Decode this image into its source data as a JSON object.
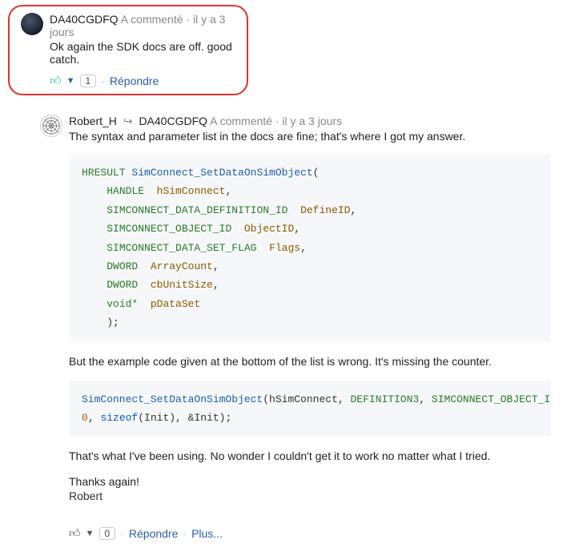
{
  "comment1": {
    "username": "DA40CGDFQ",
    "action": "A commenté",
    "time": "il y a 3 jours",
    "text": "Ok again the SDK docs are off. good catch.",
    "vote_count": "1",
    "reply_label": "Répondre"
  },
  "comment2": {
    "username": "Robert_H",
    "reply_to": "DA40CGDFQ",
    "action": "A commenté",
    "time": "il y a 3 jours",
    "intro": "The syntax and parameter list in the docs are fine; that's where I got my answer.",
    "mid_text": "But the example code given at the bottom of the list is wrong. It's missing the counter.",
    "after_text": "That's what I've been using. No wonder I couldn't get it to work no matter what I tried.",
    "thanks": "Thanks again!",
    "signoff": "Robert",
    "vote_count": "0",
    "reply_label": "Répondre",
    "more_label": "Plus..."
  },
  "code1": {
    "l1_t1": "HRESULT",
    "l1_f": "SimConnect_SetDataOnSimObject",
    "l1_p": "(",
    "l2_t": "HANDLE",
    "l2_n": "hSimConnect",
    "l2_c": ",",
    "l3_t": "SIMCONNECT_DATA_DEFINITION_ID",
    "l3_n": "DefineID",
    "l3_c": ",",
    "l4_t": "SIMCONNECT_OBJECT_ID",
    "l4_n": "ObjectID",
    "l4_c": ",",
    "l5_t": "SIMCONNECT_DATA_SET_FLAG",
    "l5_n": "Flags",
    "l5_c": ",",
    "l6_t": "DWORD",
    "l6_n": "ArrayCount",
    "l6_c": ",",
    "l7_t": "DWORD",
    "l7_n": "cbUnitSize",
    "l7_c": ",",
    "l8_t": "void*",
    "l8_n": "pDataSet",
    "l9": ");"
  },
  "code2": {
    "fn": "SimConnect_SetDataOnSimObject",
    "a1": "(hSimConnect, ",
    "a2": "DEFINITION3",
    "a3": ", ",
    "a4": "SIMCONNECT_OBJECT_ID_USER",
    "a5": ",",
    "b1": "0",
    "b2": ", ",
    "b3": "sizeof",
    "b4": "(Init), &Init);"
  }
}
